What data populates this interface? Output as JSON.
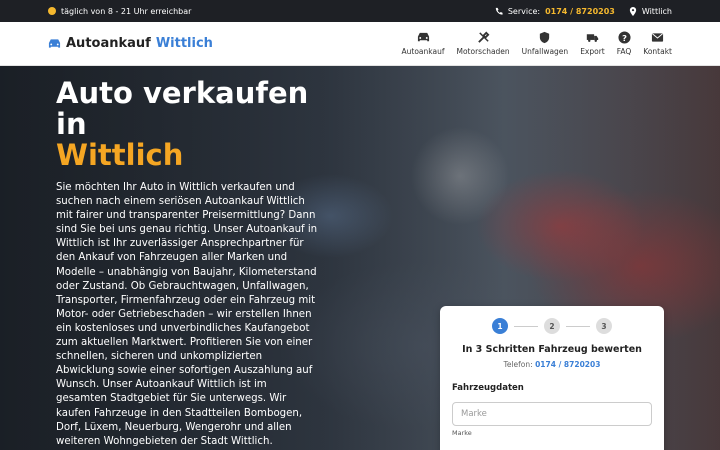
{
  "topbar": {
    "hours": "täglich von 8 - 21 Uhr erreichbar",
    "service_label": "Service:",
    "phone": "0174 / 8720203",
    "location": "Wittlich"
  },
  "brand": {
    "part1": "Autoankauf",
    "part2": "Wittlich"
  },
  "menu": [
    {
      "label": "Autoankauf",
      "icon": "car-icon"
    },
    {
      "label": "Motorschaden",
      "icon": "tools-icon"
    },
    {
      "label": "Unfallwagen",
      "icon": "shield-icon"
    },
    {
      "label": "Export",
      "icon": "truck-icon"
    },
    {
      "label": "FAQ",
      "icon": "question-icon"
    },
    {
      "label": "Kontakt",
      "icon": "envelope-icon"
    }
  ],
  "hero": {
    "title_line1": "Auto verkaufen",
    "title_line2": "in",
    "title_highlight": "Wittlich",
    "text": "Sie möchten Ihr Auto in Wittlich verkaufen und suchen nach einem seriösen Autoankauf Wittlich mit fairer und transparenter Preisermittlung? Dann sind Sie bei uns genau richtig. Unser Autoankauf in Wittlich ist Ihr zuverlässiger Ansprechpartner für den Ankauf von Fahrzeugen aller Marken und Modelle – unabhängig von Baujahr, Kilometerstand oder Zustand. Ob Gebrauchtwagen, Unfallwagen, Transporter, Firmenfahrzeug oder ein Fahrzeug mit Motor- oder Getriebeschaden – wir erstellen Ihnen ein kostenloses und unverbindliches Kaufangebot zum aktuellen Marktwert. Profitieren Sie von einer schnellen, sicheren und unkomplizierten Abwicklung sowie einer sofortigen Auszahlung auf Wunsch. Unser Autoankauf Wittlich ist im gesamten Stadtgebiet für Sie unterwegs. Wir kaufen Fahrzeuge in den Stadtteilen Bombogen, Dorf, Lüxem, Neuerburg, Wengerohr und allen weiteren Wohngebieten der Stadt Wittlich."
  },
  "form": {
    "steps": [
      "1",
      "2",
      "3"
    ],
    "active_step": 1,
    "title": "In 3 Schritten Fahrzeug bewerten",
    "tel_label": "Telefon:",
    "tel": "0174 / 8720203",
    "section": "Fahrzeugdaten",
    "field_placeholder": "Marke",
    "field_hint": "Marke"
  },
  "colors": {
    "accent_blue": "#3a7fd6",
    "accent_orange": "#f5a623",
    "topbar_bg": "#1e2025"
  }
}
